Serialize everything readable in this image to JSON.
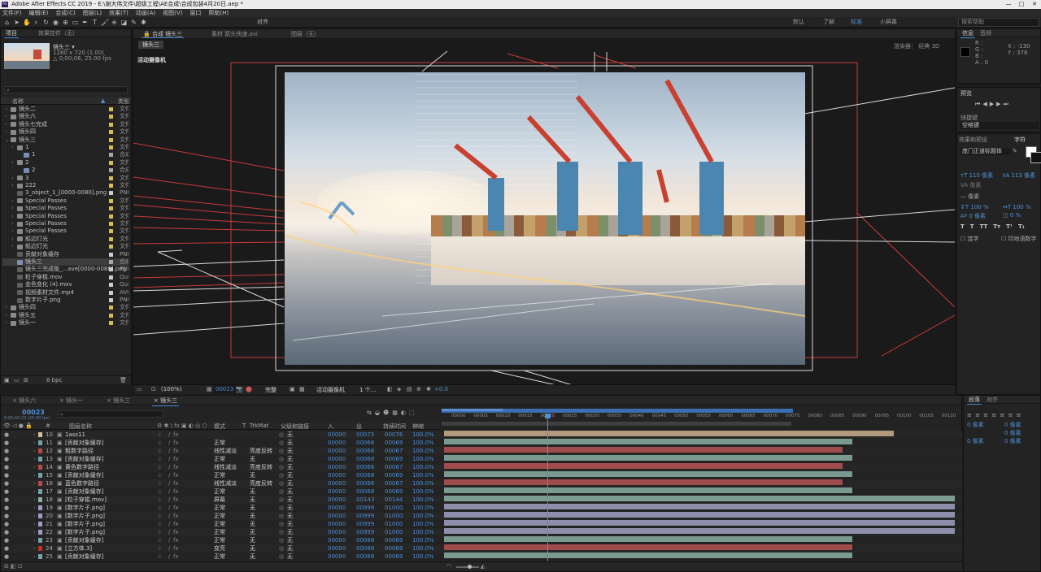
{
  "window": {
    "title": "Adobe After Effects CC 2019 - E:\\谢大伟文件\\超级工程\\AE合成\\合成包装4月20日.aep *",
    "app_logo": "Ae",
    "min": "—",
    "max": "□",
    "close": "✕"
  },
  "menu": [
    "文件(F)",
    "编辑(E)",
    "合成(C)",
    "图层(L)",
    "效果(T)",
    "动画(A)",
    "视图(V)",
    "窗口",
    "帮助(H)"
  ],
  "toolbar": {
    "align_label": "对齐",
    "workspaces": [
      "默认",
      "了解",
      "标准",
      "小屏幕"
    ],
    "active_workspace": "标准",
    "search_placeholder": "搜索帮助",
    "tool_icons": [
      "home-icon",
      "selection-tool-icon",
      "hand-tool-icon",
      "zoom-tool-icon",
      "rotate-tool-icon",
      "camera-tool-icon",
      "pan-behind-tool-icon",
      "rectangle-tool-icon",
      "pen-tool-icon",
      "text-tool-icon",
      "brush-tool-icon",
      "clone-stamp-tool-icon",
      "eraser-tool-icon",
      "roto-brush-tool-icon",
      "puppet-tool-icon"
    ]
  },
  "project": {
    "tabs": [
      "项目",
      "效果控件（无）"
    ],
    "thumb_name": "镜头三 ▾",
    "thumb_info": [
      "1280 x 720 (1.00)",
      "△ 0;00;06, 25.00 fps"
    ],
    "search_placeholder": "",
    "col_name": "名称",
    "col_type": "类型",
    "items": [
      {
        "name": "镜头二",
        "type": "文件",
        "indent": 0,
        "kind": "folder"
      },
      {
        "name": "镜头六",
        "type": "文件",
        "indent": 0,
        "kind": "folder"
      },
      {
        "name": "镜头七完成",
        "type": "文件",
        "indent": 0,
        "kind": "folder"
      },
      {
        "name": "镜头四",
        "type": "文件",
        "indent": 0,
        "kind": "folder"
      },
      {
        "name": "镜头三",
        "type": "文件",
        "indent": 0,
        "kind": "folder"
      },
      {
        "name": "1",
        "type": "文件",
        "indent": 1,
        "kind": "folder"
      },
      {
        "name": "1",
        "type": "合成",
        "indent": 2,
        "kind": "comp"
      },
      {
        "name": "2",
        "type": "文件",
        "indent": 1,
        "kind": "folder"
      },
      {
        "name": "2",
        "type": "合成",
        "indent": 2,
        "kind": "comp"
      },
      {
        "name": "3",
        "type": "文件",
        "indent": 1,
        "kind": "folder"
      },
      {
        "name": "222",
        "type": "文件",
        "indent": 1,
        "kind": "folder"
      },
      {
        "name": "3_object_1_[0000-0080].png",
        "type": "PNG",
        "indent": 1,
        "kind": "file"
      },
      {
        "name": "Special Passes",
        "type": "文件",
        "indent": 1,
        "kind": "folder"
      },
      {
        "name": "Special Passes",
        "type": "文件",
        "indent": 1,
        "kind": "folder"
      },
      {
        "name": "Special Passes",
        "type": "文件",
        "indent": 1,
        "kind": "folder"
      },
      {
        "name": "Special Passes",
        "type": "文件",
        "indent": 1,
        "kind": "folder"
      },
      {
        "name": "Special Passes",
        "type": "文件",
        "indent": 1,
        "kind": "folder"
      },
      {
        "name": "船边灯光",
        "type": "文件",
        "indent": 1,
        "kind": "folder"
      },
      {
        "name": "船边灯光",
        "type": "文件",
        "indent": 1,
        "kind": "folder"
      },
      {
        "name": "贡献对象缓存",
        "type": "PNG",
        "indent": 1,
        "kind": "file"
      },
      {
        "name": "镜头三",
        "type": "合成",
        "indent": 1,
        "kind": "comp",
        "selected": true
      },
      {
        "name": "镜头三完成版_...ave[0000-0080].png",
        "type": "PNG",
        "indent": 1,
        "kind": "file"
      },
      {
        "name": "粒子穿梭.mov",
        "type": "Qui",
        "indent": 1,
        "kind": "file"
      },
      {
        "name": "金色变化 (4).mov",
        "type": "Qui",
        "indent": 1,
        "kind": "file"
      },
      {
        "name": "视频素材文件.mp4",
        "type": "AVI",
        "indent": 1,
        "kind": "file"
      },
      {
        "name": "数字片子.png",
        "type": "PNG",
        "indent": 1,
        "kind": "file"
      },
      {
        "name": "镜头四",
        "type": "文件",
        "indent": 0,
        "kind": "folder"
      },
      {
        "name": "镜头五",
        "type": "文件",
        "indent": 0,
        "kind": "folder"
      },
      {
        "name": "镜头一",
        "type": "文件",
        "indent": 0,
        "kind": "folder"
      }
    ],
    "bpc": "8 bpc"
  },
  "viewer": {
    "tabs": [
      "合成 镜头三",
      "素材 箭头快速.avi",
      "图层（无）"
    ],
    "comp_chip": "镜头三",
    "camera_label": "活动摄像机",
    "renderer": "渲染器：",
    "renderer_value": "经典 3D",
    "zoom": "(100%)",
    "timecode": "00023",
    "quality": "完整",
    "camera_select": "活动摄像机",
    "view_count": "1 个...",
    "exposure": "+0.0"
  },
  "right_panels": {
    "info_tabs": [
      "信息",
      "音频"
    ],
    "info_rgb": [
      "R :",
      "G :",
      "B :",
      "A : 0"
    ],
    "info_xy": [
      "X : -130",
      "Y : 378"
    ],
    "preview": {
      "title": "预览",
      "shortcut_label": "快捷键",
      "shortcut_value": "空格键"
    },
    "effects": {
      "title": "效果和预设",
      "char_tab": "字符",
      "font": "庞门正道标题体",
      "font_size": "110 像素",
      "leading": "113 像素",
      "unit_label": "像素",
      "tracking": "— 像素",
      "vscale": "100 %",
      "hscale": "100 %",
      "baseline": "0 像素",
      "tsume": "0 %",
      "format_buttons": [
        "T",
        "T",
        "TT",
        "Tт",
        "T¹",
        "T₁"
      ],
      "ligature": "连字",
      "hindi": "印地语数字"
    },
    "para": {
      "tabs": [
        "段落",
        "对齐"
      ],
      "indent_vals": [
        "0 像素",
        "0 像素",
        "0 像素",
        "0 像素",
        "0 像素"
      ]
    }
  },
  "timeline": {
    "tabs": [
      "镜头六",
      "镜头一",
      "镜头三",
      "镜头三"
    ],
    "active_tab": 3,
    "current_time": "00023",
    "time_sub": "0:00:00:23 (25.00 fps)",
    "search_placeholder": "",
    "col_headers": {
      "num": "#",
      "name": "图层名称",
      "mode": "模式",
      "t": "T",
      "trkmat": "TrkMat",
      "parent": "父级和链接",
      "in": "入",
      "out": "出",
      "dur": "持续时间",
      "stretch": "伸缩"
    },
    "ticks": [
      "00000",
      "00005",
      "00010",
      "00015",
      "00020",
      "00025",
      "00030",
      "00035",
      "00040",
      "00045",
      "00050",
      "00055",
      "00060",
      "00065",
      "00070",
      "00075",
      "00080",
      "00085",
      "00090",
      "00095",
      "00100",
      "00105",
      "00110"
    ],
    "layers": [
      {
        "num": "10",
        "name": "1ass11",
        "mode": "",
        "trk": "",
        "parent": "无",
        "in": "00000",
        "out": "00075",
        "dur": "00076",
        "stretch": "100.0%",
        "color": "#d6c09a",
        "bar": "#b19a7e",
        "bar_end": 0.88
      },
      {
        "num": "11",
        "name": "[贡献对象缓存]",
        "mode": "正常",
        "trk": "",
        "parent": "无",
        "in": "00000",
        "out": "00068",
        "dur": "00069",
        "stretch": "100.0%",
        "color": "#74a3a3",
        "bar": "#7a9a8f",
        "bar_end": 0.8
      },
      {
        "num": "12",
        "name": "粗数字路径",
        "mode": "线性减淡",
        "trk": "亮度反转",
        "parent": "无",
        "in": "00000",
        "out": "00066",
        "dur": "00067",
        "stretch": "100.0%",
        "color": "#b94a4a",
        "bar": "#a14c4c",
        "bar_end": 0.78
      },
      {
        "num": "13",
        "name": "[贡献对象缓存]",
        "mode": "正常",
        "trk": "无",
        "parent": "无",
        "in": "00000",
        "out": "00068",
        "dur": "00069",
        "stretch": "100.0%",
        "color": "#74a3a3",
        "bar": "#7a9a8f",
        "bar_end": 0.8
      },
      {
        "num": "14",
        "name": "黄色数字路径",
        "mode": "线性减淡",
        "trk": "亮度反转",
        "parent": "无",
        "in": "00000",
        "out": "00066",
        "dur": "00067",
        "stretch": "100.0%",
        "color": "#b94a4a",
        "bar": "#a14c4c",
        "bar_end": 0.78
      },
      {
        "num": "15",
        "name": "[贡献对象缓存]",
        "mode": "正常",
        "trk": "无",
        "parent": "无",
        "in": "00000",
        "out": "00068",
        "dur": "00069",
        "stretch": "100.0%",
        "color": "#74a3a3",
        "bar": "#7a9a8f",
        "bar_end": 0.8
      },
      {
        "num": "16",
        "name": "蓝色数字路径",
        "mode": "线性减淡",
        "trk": "亮度反转",
        "parent": "无",
        "in": "00000",
        "out": "00066",
        "dur": "00067",
        "stretch": "100.0%",
        "color": "#b94a4a",
        "bar": "#a14c4c",
        "bar_end": 0.78
      },
      {
        "num": "17",
        "name": "[贡献对象缓存]",
        "mode": "正常",
        "trk": "无",
        "parent": "无",
        "in": "00000",
        "out": "00068",
        "dur": "00069",
        "stretch": "100.0%",
        "color": "#74a3a3",
        "bar": "#7a9a8f",
        "bar_end": 0.8
      },
      {
        "num": "18",
        "name": "[粒子穿梭.mov]",
        "mode": "屏幕",
        "trk": "无",
        "parent": "无",
        "in": "00000",
        "out": "00143",
        "dur": "00144",
        "stretch": "100.0%",
        "color": "#8ab0a8",
        "bar": "#7d9c92",
        "bar_end": 1.0
      },
      {
        "num": "19",
        "name": "[数字片子.png]",
        "mode": "正常",
        "trk": "无",
        "parent": "无",
        "in": "00000",
        "out": "00999",
        "dur": "01000",
        "stretch": "100.0%",
        "color": "#9c9cc8",
        "bar": "#8e8eaa",
        "bar_end": 1.0
      },
      {
        "num": "20",
        "name": "[数字片子.png]",
        "mode": "正常",
        "trk": "无",
        "parent": "无",
        "in": "00000",
        "out": "00999",
        "dur": "01000",
        "stretch": "100.0%",
        "color": "#9c9cc8",
        "bar": "#8e8eaa",
        "bar_end": 1.0
      },
      {
        "num": "21",
        "name": "[数字片子.png]",
        "mode": "正常",
        "trk": "无",
        "parent": "无",
        "in": "00000",
        "out": "00999",
        "dur": "01000",
        "stretch": "100.0%",
        "color": "#9c9cc8",
        "bar": "#8e8eaa",
        "bar_end": 1.0
      },
      {
        "num": "22",
        "name": "[数字片子.png]",
        "mode": "正常",
        "trk": "无",
        "parent": "无",
        "in": "00000",
        "out": "00999",
        "dur": "01000",
        "stretch": "100.0%",
        "color": "#9c9cc8",
        "bar": "#8e8eaa",
        "bar_end": 1.0
      },
      {
        "num": "23",
        "name": "[贡献对象缓存]",
        "mode": "正常",
        "trk": "无",
        "parent": "无",
        "in": "00000",
        "out": "00068",
        "dur": "00069",
        "stretch": "100.0%",
        "color": "#74a3a3",
        "bar": "#7a9a8f",
        "bar_end": 0.8
      },
      {
        "num": "24",
        "name": "[立方体.3]",
        "mode": "变亮",
        "trk": "无",
        "parent": "无",
        "in": "00000",
        "out": "00068",
        "dur": "00069",
        "stretch": "100.0%",
        "color": "#cc2a2a",
        "bar": "#a14c4c",
        "bar_end": 0.8
      },
      {
        "num": "25",
        "name": "[贡献对象缓存]",
        "mode": "正常",
        "trk": "无",
        "parent": "无",
        "in": "00000",
        "out": "00068",
        "dur": "00069",
        "stretch": "100.0%",
        "color": "#74a3a3",
        "bar": "#7a9a8f",
        "bar_end": 0.8
      }
    ]
  }
}
